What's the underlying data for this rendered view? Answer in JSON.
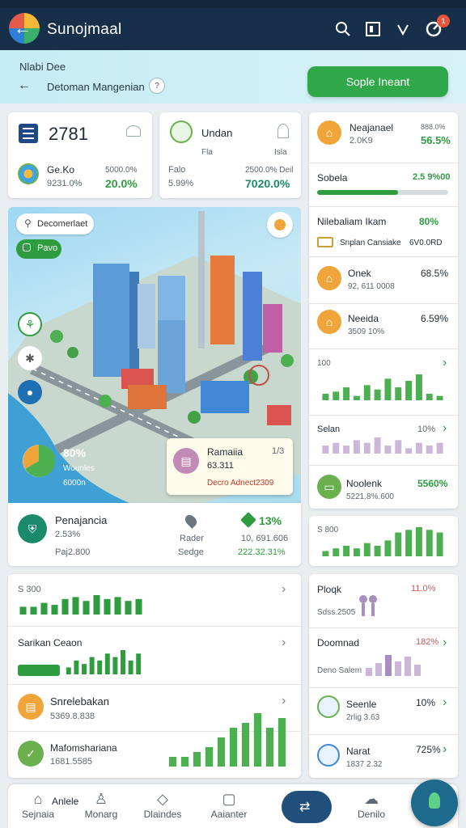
{
  "appbar": {
    "title": "Sunojmaal",
    "icons": [
      "search-icon",
      "calendar-icon",
      "heart-icon",
      "gauge-icon"
    ],
    "notification_count": "1"
  },
  "banner": {
    "top_text": "Nlabi Dee",
    "subtitle": "Detoman Mangenian",
    "button_label": "Sople Ineant"
  },
  "stat_cards": [
    {
      "value": "2781",
      "name": "Ge.Ko",
      "meta": "9231.0%",
      "sub_meta": "5000.0%",
      "percent": "20.0%"
    },
    {
      "title": "Undan",
      "label": "Fla",
      "label2": "Isla",
      "name": "Falo",
      "meta": "5.99%",
      "sub_meta": "2500.0% Deil",
      "percent": "7020.0%"
    }
  ],
  "map": {
    "search_placeholder": "Decomerlaet",
    "chip_label": "Pavo",
    "pie_percent": "80%",
    "pie_sub1": "Wounles",
    "pie_sub2": "6000n",
    "popup": {
      "title": "Ramaiia",
      "tag": "1/3",
      "value": "63.311",
      "footer": "Decro Adnect2309"
    }
  },
  "map_footer": {
    "title": "Penajancia",
    "value": "2.53%",
    "sub": "Paj2.800",
    "mid_label1": "Rader",
    "mid_label2": "Sedge",
    "right_percent": "13%",
    "right_value": "10, 691.606",
    "right_sub": "222.32.31%"
  },
  "left_list": [
    {
      "label": "S 300"
    },
    {
      "label": "Sarikan Ceaon"
    },
    {
      "label": "Snrelebakan",
      "sub": "5369.8.838"
    },
    {
      "label": "Mafomshariana",
      "sub": "1681.5585"
    }
  ],
  "right_list": [
    {
      "title": "Neajanael",
      "value": "2.0K9",
      "meta": "888.0%",
      "percent": "56.5%"
    },
    {
      "title": "Sobela",
      "percent": "2.5 9%00"
    },
    {
      "title": "Nilebaliam Ikam",
      "percent": "80%",
      "sub": "Snplan Cansiake",
      "sub_value": "6V0.0RD"
    },
    {
      "title": "Onek",
      "sub": "92, 611 0008",
      "percent": "68.5%"
    },
    {
      "title": "Neeida",
      "sub": "3509 10%",
      "percent": "6.59%"
    },
    {
      "label": "100"
    },
    {
      "title": "Selan",
      "percent": "10%"
    },
    {
      "title": "Noolenk",
      "sub": "5221.8%.600",
      "percent": "5560%"
    },
    {
      "label": "S 800"
    },
    {
      "title": "Ploqk",
      "sub": "Sdss.2505",
      "percent": "11.0%"
    },
    {
      "title": "Doomnad",
      "sub": "Deno Salem",
      "percent": "182%"
    },
    {
      "title": "Seenle",
      "sub": "2rlig 3.63",
      "percent": "10%"
    },
    {
      "title": "Narat",
      "sub": "1837 2.32",
      "percent": "725%"
    }
  ],
  "bottom_nav": [
    {
      "label": "Sejnaia",
      "top": "Anlele"
    },
    {
      "label": "Monarg"
    },
    {
      "label": "Dlaindes"
    },
    {
      "label": "Aaianter"
    },
    {
      "label": "Denilo"
    }
  ],
  "chart_data": [
    {
      "type": "bar",
      "name": "right-chart-100",
      "ylabel": "100",
      "values": [
        3,
        4,
        6,
        2,
        7,
        5,
        10,
        6,
        9,
        12,
        3,
        2
      ]
    },
    {
      "type": "bar",
      "name": "right-chart-selan",
      "values": [
        3,
        4,
        3,
        5,
        4,
        6,
        3,
        5,
        2,
        4,
        3,
        4
      ]
    },
    {
      "type": "bar",
      "name": "right-chart-800",
      "values": [
        2,
        3,
        4,
        3,
        5,
        4,
        6,
        9,
        10,
        11,
        10,
        9
      ]
    },
    {
      "type": "bar",
      "name": "left-chart-300",
      "values": [
        4,
        4,
        6,
        5,
        8,
        9,
        7,
        10,
        8,
        9,
        7,
        8
      ]
    },
    {
      "type": "bar",
      "name": "left-chart-sarikan",
      "values": [
        2,
        4,
        3,
        5,
        4,
        6,
        5,
        7,
        4,
        6
      ]
    },
    {
      "type": "bar",
      "name": "left-chart-bottom",
      "values": [
        2,
        2,
        3,
        4,
        6,
        8,
        9,
        11,
        8,
        10
      ]
    }
  ],
  "colors": {
    "green": "#2f9d3f",
    "accent": "#172f48",
    "banner": "#c6ecf5"
  }
}
